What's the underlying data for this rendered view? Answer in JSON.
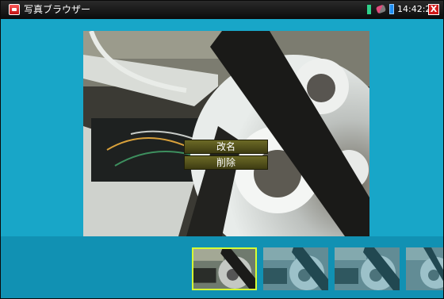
{
  "status_bar": {
    "app_title": "写真ブラウザー",
    "time": "14:42:23",
    "close_symbol": "X",
    "icons": [
      "app-icon",
      "signal-icon",
      "usb-icon",
      "battery-icon",
      "close-icon"
    ]
  },
  "context_menu": {
    "rename_label": "改名",
    "delete_label": "削除"
  },
  "thumbnails": {
    "count_visible": 4,
    "selected_index": 0
  },
  "colors": {
    "background": "#18a6c8",
    "strip": "#1191b3",
    "selected_border": "#d6ff34",
    "menu": "#55531e"
  }
}
